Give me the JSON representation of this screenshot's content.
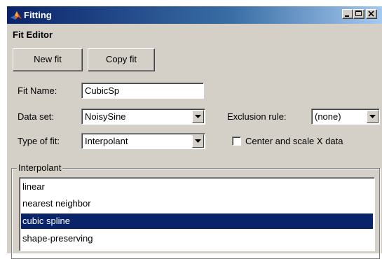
{
  "window": {
    "title": "Fitting"
  },
  "editor": {
    "heading": "Fit Editor",
    "new_fit_label": "New fit",
    "copy_fit_label": "Copy fit",
    "fit_name_label": "Fit Name:",
    "fit_name_value": "CubicSp",
    "data_set_label": "Data set:",
    "data_set_value": "NoisySine",
    "exclusion_label": "Exclusion rule:",
    "exclusion_value": "(none)",
    "type_label": "Type of fit:",
    "type_value": "Interpolant",
    "center_scale_label": "Center and scale X data",
    "center_scale_checked": false
  },
  "interpolant": {
    "group_title": "Interpolant",
    "items": [
      {
        "label": "linear",
        "selected": false
      },
      {
        "label": "nearest neighbor",
        "selected": false
      },
      {
        "label": "cubic spline",
        "selected": true
      },
      {
        "label": "shape-preserving",
        "selected": false
      }
    ]
  },
  "colors": {
    "titlebar": "#0a246a",
    "face": "#d4d0c8",
    "selection": "#0a246a"
  },
  "icons": {
    "app": "matlab-logo-icon",
    "minimize": "minimize-icon",
    "maximize": "maximize-icon",
    "close": "close-icon",
    "dropdown": "chevron-down-icon"
  }
}
